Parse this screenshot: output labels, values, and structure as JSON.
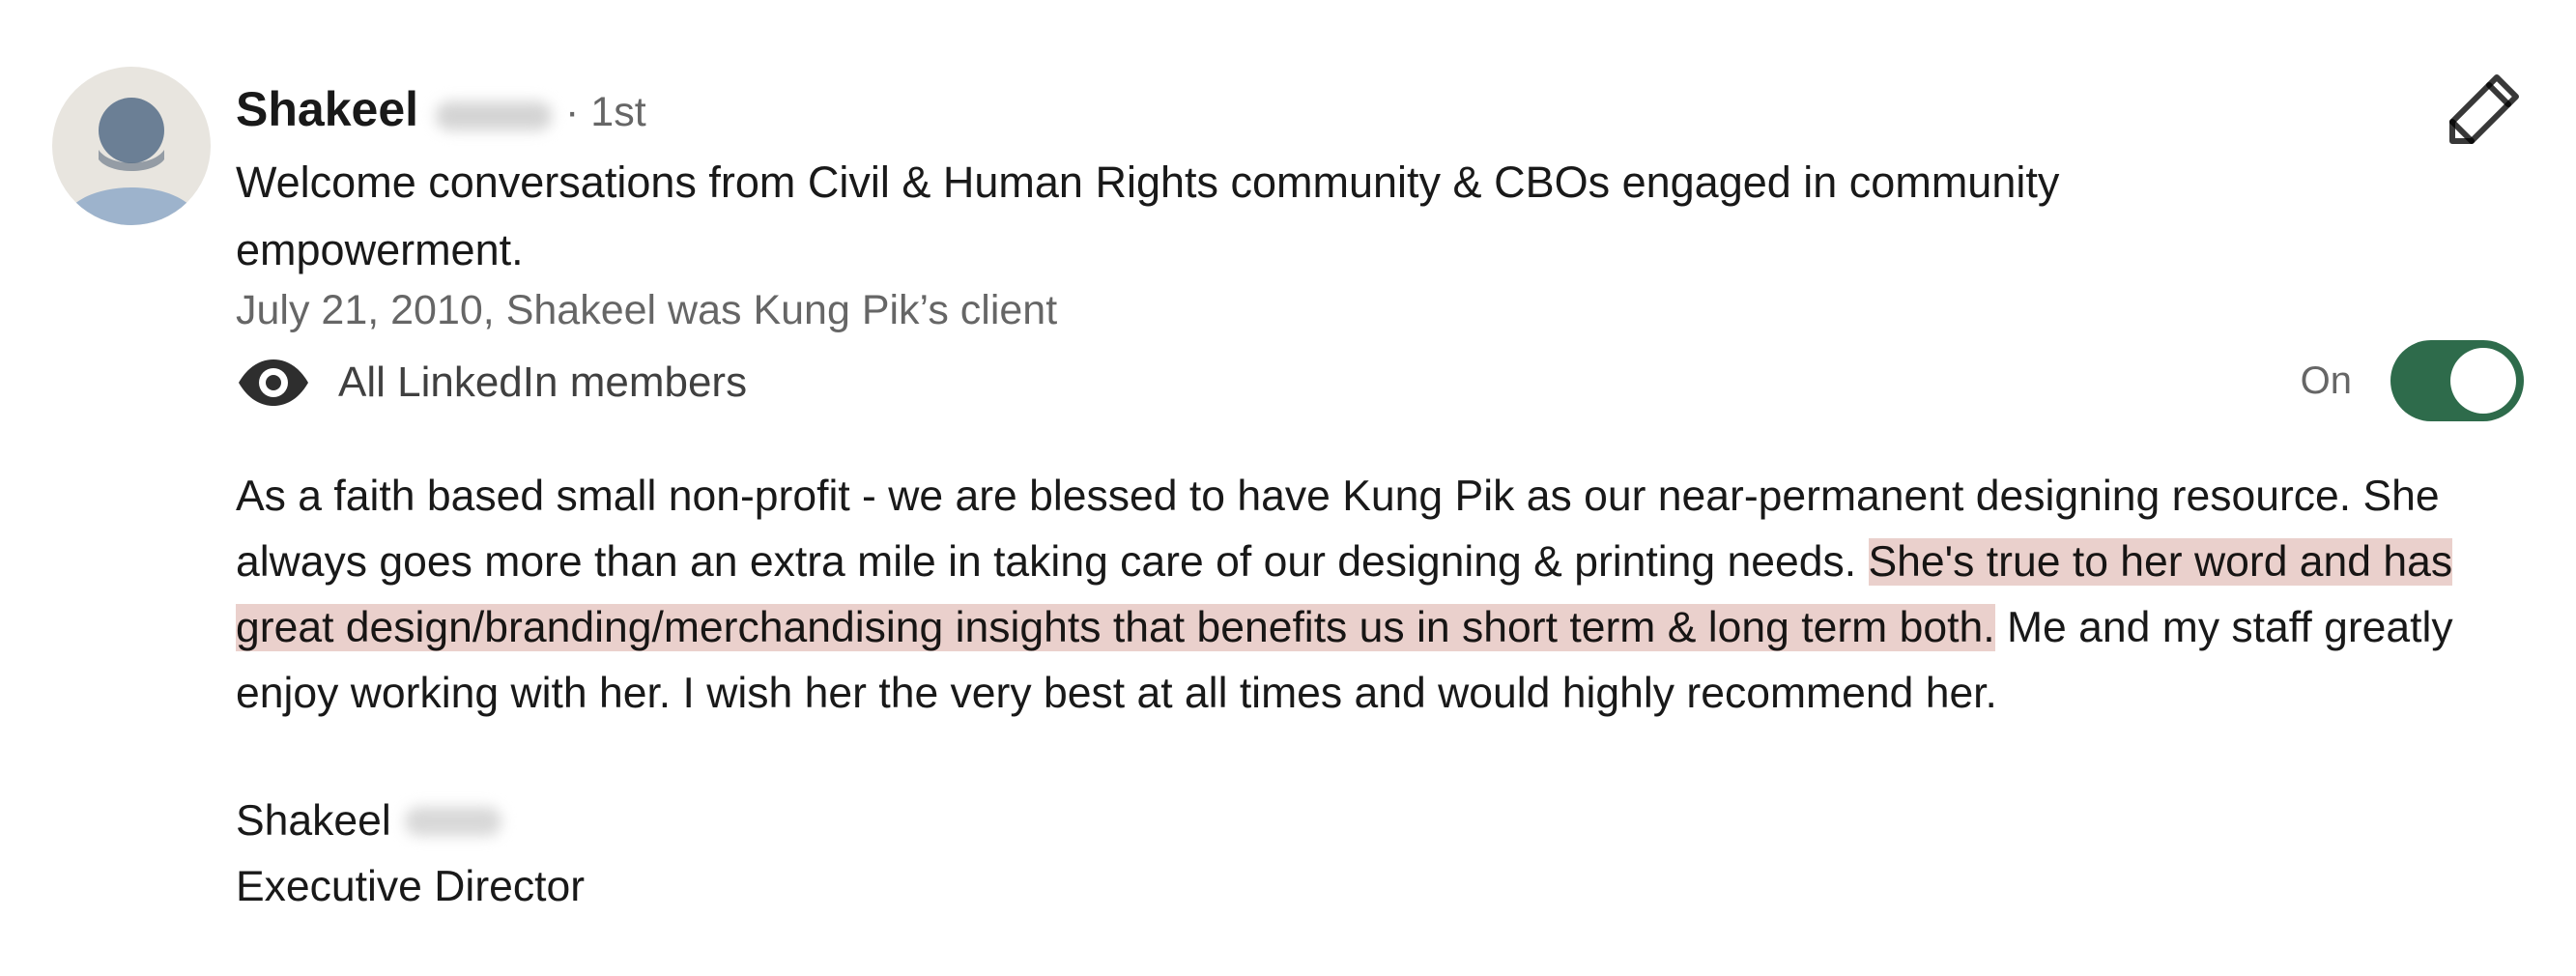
{
  "recommendation": {
    "author_first_name": "Shakeel",
    "connection_degree": "· 1st",
    "headline": "Welcome conversations from Civil & Human Rights community & CBOs engaged in community empowerment.",
    "meta": "July 21, 2010, Shakeel was Kung Pik’s client",
    "visibility_label": "All LinkedIn members",
    "visibility_icon": "eye-icon",
    "toggle_label": "On",
    "toggle_state": "on",
    "edit_icon": "pencil-icon",
    "body": {
      "part1": "As a faith based small non-profit - we are blessed to have Kung Pik as our near-permanent designing resource. She always goes more than an extra mile in taking care of our designing & printing needs.",
      "highlighted": "She's true to her word and has great design/branding/merchandising insights that benefits us in short term & long term both.",
      "part2": "Me and my staff greatly enjoy working with her. I wish her the very best at all times and would highly recommend her."
    },
    "signature": {
      "name": "Shakeel",
      "title": "Executive Director"
    }
  },
  "colors": {
    "toggle_on": "#2e6b4b",
    "highlight": "#ead0cc",
    "avatar_bg": "#e8e5df",
    "avatar_figure": "#9db3cc"
  }
}
